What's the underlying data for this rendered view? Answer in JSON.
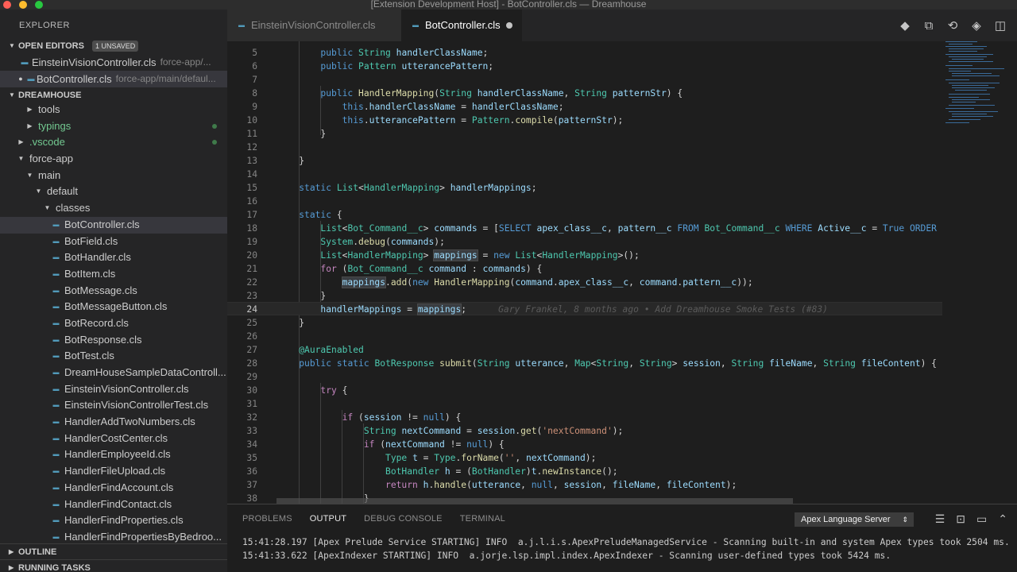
{
  "window": {
    "title": "[Extension Development Host] - BotController.cls — Dreamhouse"
  },
  "sidebar": {
    "title": "EXPLORER",
    "open_editors": {
      "label": "OPEN EDITORS",
      "badge": "1 UNSAVED",
      "items": [
        {
          "name": "EinsteinVisionController.cls",
          "path": "force-app/..."
        },
        {
          "name": "BotController.cls",
          "path": "force-app/main/defaul..."
        }
      ]
    },
    "project_label": "DREAMHOUSE",
    "tree": [
      "tools",
      "typings",
      ".vscode",
      "force-app",
      "main",
      "default",
      "classes",
      "BotController.cls",
      "BotField.cls",
      "BotHandler.cls",
      "BotItem.cls",
      "BotMessage.cls",
      "BotMessageButton.cls",
      "BotRecord.cls",
      "BotResponse.cls",
      "BotTest.cls",
      "DreamHouseSampleDataControll...",
      "EinsteinVisionController.cls",
      "EinsteinVisionControllerTest.cls",
      "HandlerAddTwoNumbers.cls",
      "HandlerCostCenter.cls",
      "HandlerEmployeeId.cls",
      "HandlerFileUpload.cls",
      "HandlerFindAccount.cls",
      "HandlerFindContact.cls",
      "HandlerFindProperties.cls",
      "HandlerFindPropertiesByBedroo..."
    ],
    "outline_label": "OUTLINE",
    "running_tasks_label": "RUNNING TASKS"
  },
  "tabs": [
    {
      "label": "EinsteinVisionController.cls"
    },
    {
      "label": "BotController.cls"
    }
  ],
  "editor": {
    "line_numbers": [
      "5",
      "6",
      "7",
      "8",
      "9",
      "10",
      "11",
      "12",
      "13",
      "14",
      "15",
      "16",
      "17",
      "18",
      "19",
      "20",
      "21",
      "22",
      "23",
      "24",
      "25",
      "26",
      "27",
      "28",
      "29",
      "30",
      "31",
      "32",
      "33",
      "34",
      "35",
      "36",
      "37",
      "38"
    ],
    "blame": "Gary Frankel, 8 months ago • Add Dreamhouse Smoke Tests (#83)"
  },
  "panel": {
    "tabs": [
      "PROBLEMS",
      "OUTPUT",
      "DEBUG CONSOLE",
      "TERMINAL"
    ],
    "active_tab": "OUTPUT",
    "selector": "Apex Language Server",
    "lines": [
      "15:41:28.197 [Apex Prelude Service STARTING] INFO  a.j.l.i.s.ApexPreludeManagedService - Scanning built-in and system Apex types took 2504 ms.",
      "15:41:33.622 [ApexIndexer STARTING] INFO  a.jorje.lsp.impl.index.ApexIndexer - Scanning user-defined types took 5424 ms."
    ]
  },
  "colors": {
    "accent": "#007acc",
    "keyword": "#569cd6",
    "type": "#4ec9b0",
    "variable": "#9cdcfe"
  }
}
